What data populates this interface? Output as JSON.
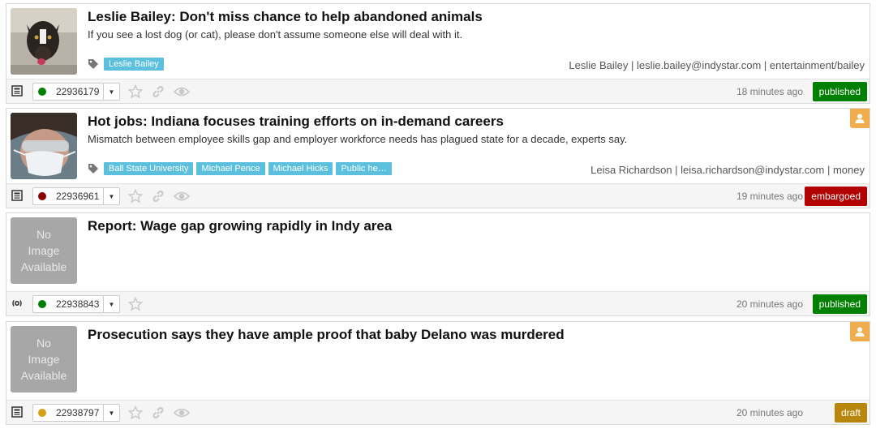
{
  "colors": {
    "published": "#008000",
    "embargoed": "#b30000",
    "draft": "#b8860b",
    "tag": "#5bc0de",
    "dot_green": "#008000",
    "dot_darkred": "#8b0000",
    "dot_gold": "#d4a017"
  },
  "no_image_text": "No Image Available",
  "stories": [
    {
      "title": "Leslie Bailey: Don't miss chance to help abandoned animals",
      "description": "If you see a lost dog (or cat), please don't assume someone else will deal with it.",
      "tags": [
        "Leslie Bailey"
      ],
      "byline": "Leslie Bailey | leslie.bailey@indystar.com | entertainment/bailey",
      "id": "22936179",
      "time": "18 minutes ago",
      "status": "published",
      "thumb": "dog-photo",
      "type_icon": "article-icon"
    },
    {
      "title": "Hot jobs: Indiana focuses training efforts on in-demand careers",
      "description": "Mismatch between employee skills gap and employer workforce needs has plagued state for a decade, experts say.",
      "tags": [
        "Ball State University",
        "Michael Pence",
        "Michael Hicks",
        "Public he…"
      ],
      "byline": "Leisa Richardson | leisa.richardson@indystar.com | money",
      "id": "22936961",
      "time": "19 minutes ago",
      "status": "embargoed",
      "thumb": "worker-photo",
      "type_icon": "article-icon"
    },
    {
      "title": "Report: Wage gap growing rapidly in Indy area",
      "description": "",
      "tags": [],
      "byline": "",
      "id": "22938843",
      "time": "20 minutes ago",
      "status": "published",
      "thumb": "none",
      "type_icon": "broadcast-icon"
    },
    {
      "title": "Prosecution says they have ample proof that baby Delano was murdered",
      "description": "",
      "tags": [],
      "byline": "",
      "id": "22938797",
      "time": "20 minutes ago",
      "status": "draft",
      "thumb": "none",
      "type_icon": "article-icon"
    }
  ]
}
